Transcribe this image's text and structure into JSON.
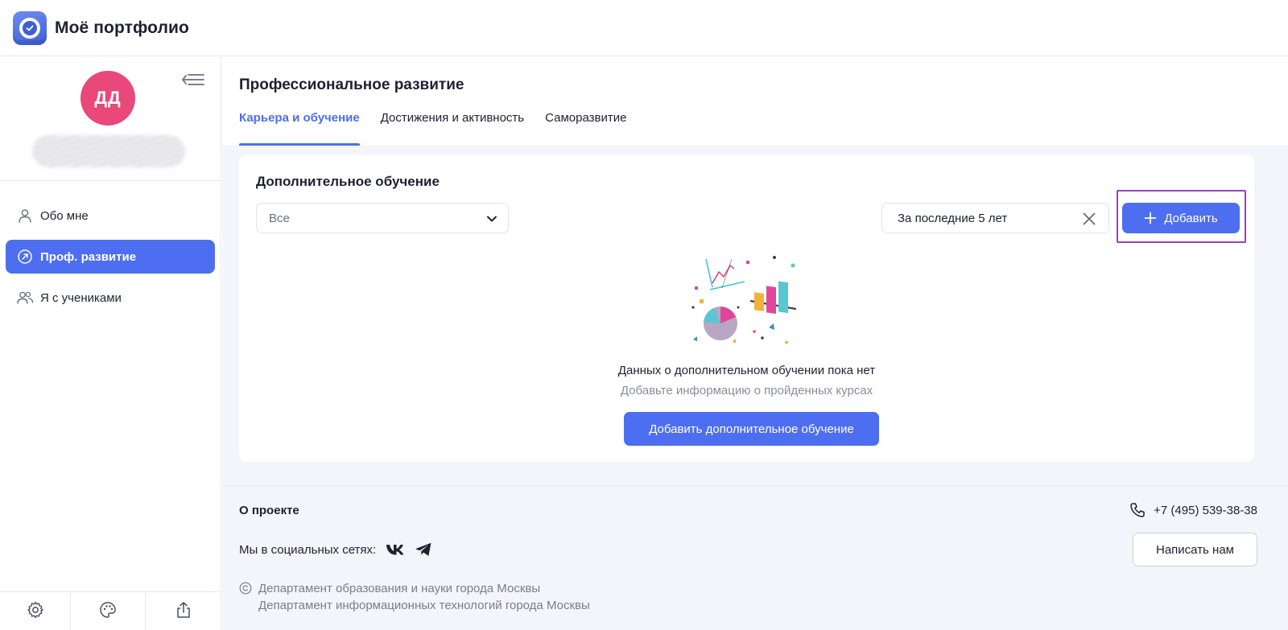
{
  "header": {
    "brand": "Моё портфолио"
  },
  "sidebar": {
    "avatar_initials": "ДД",
    "nav": [
      {
        "label": "Обо мне",
        "icon": "user-icon",
        "active": false
      },
      {
        "label": "Проф. развитие",
        "icon": "arrow-circle-icon",
        "active": true
      },
      {
        "label": "Я с учениками",
        "icon": "users-icon",
        "active": false
      }
    ],
    "bottom_icons": [
      "gear-icon",
      "palette-icon",
      "share-icon"
    ]
  },
  "main": {
    "title": "Профессиональное развитие",
    "tabs": [
      {
        "label": "Карьера и обучение",
        "active": true
      },
      {
        "label": "Достижения и активность",
        "active": false
      },
      {
        "label": "Саморазвитие",
        "active": false
      }
    ],
    "card": {
      "title": "Дополнительное обучение",
      "filter_value": "Все",
      "period_value": "За последние 5 лет",
      "add_label": "Добавить",
      "empty_title": "Данных о дополнительном обучении пока нет",
      "empty_subtitle": "Добавьте информацию о пройденных курсах",
      "cta_label": "Добавить дополнительное обучение"
    }
  },
  "footer": {
    "about": "О проекте",
    "social_label": "Мы в социальных сетях:",
    "phone": "+7 (495) 539-38-38",
    "write_us": "Написать нам",
    "copyright_line1": "Департамент образования и науки города Москвы",
    "copyright_line2": "Департамент информационных технологий города Москвы"
  },
  "colors": {
    "accent": "#4d6ef0",
    "avatar": "#e8497a",
    "highlight": "#9b3fc0"
  }
}
